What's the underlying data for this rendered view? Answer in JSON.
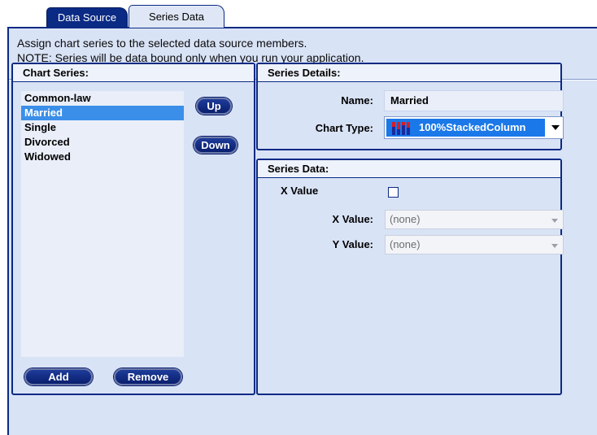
{
  "tabs": [
    {
      "label": "Data Source"
    },
    {
      "label": "Series Data"
    }
  ],
  "description": {
    "line1": "Assign chart series to the selected data source members.",
    "line2": "NOTE: Series will be data bound only when you run your application."
  },
  "chart_series": {
    "title": "Chart Series:",
    "items": [
      "Common-law",
      "Married",
      "Single",
      "Divorced",
      "Widowed"
    ],
    "selected": "Married",
    "up_label": "Up",
    "down_label": "Down",
    "add_label": "Add",
    "remove_label": "Remove"
  },
  "series_details": {
    "title": "Series Details:",
    "name_label": "Name:",
    "name_value": "Married",
    "chart_type_label": "Chart Type:",
    "chart_type_value": "100%StackedColumn"
  },
  "series_data": {
    "title": "Series Data:",
    "x_value_checkbox_label": "X Value",
    "x_value_checked": false,
    "x_value_label": "X Value:",
    "x_value_selected": "(none)",
    "y_value_label": "Y Value:",
    "y_value_selected": "(none)"
  },
  "colors": {
    "accent": "#0a2a84",
    "panel_bg": "#d9e3f6",
    "selection": "#3b8fe8"
  }
}
